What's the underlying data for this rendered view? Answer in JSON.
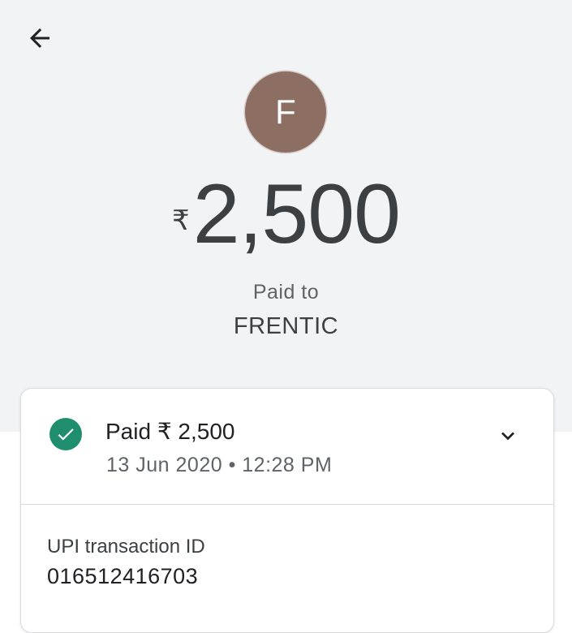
{
  "header": {
    "back_icon": "arrow-back-icon",
    "avatar_initial": "F",
    "avatar_color": "#8d6e63",
    "currency_symbol": "₹",
    "amount": "2,500",
    "paid_to_label": "Paid to",
    "payee_name": "FRENTIC"
  },
  "status_card": {
    "status_icon": "check-circle-icon",
    "status_color": "#1e8e6e",
    "title": "Paid ₹ 2,500",
    "date_time": "13 Jun 2020 • 12:28 PM",
    "expand_icon": "chevron-down-icon"
  },
  "transaction": {
    "label": "UPI transaction ID",
    "id": "016512416703"
  }
}
